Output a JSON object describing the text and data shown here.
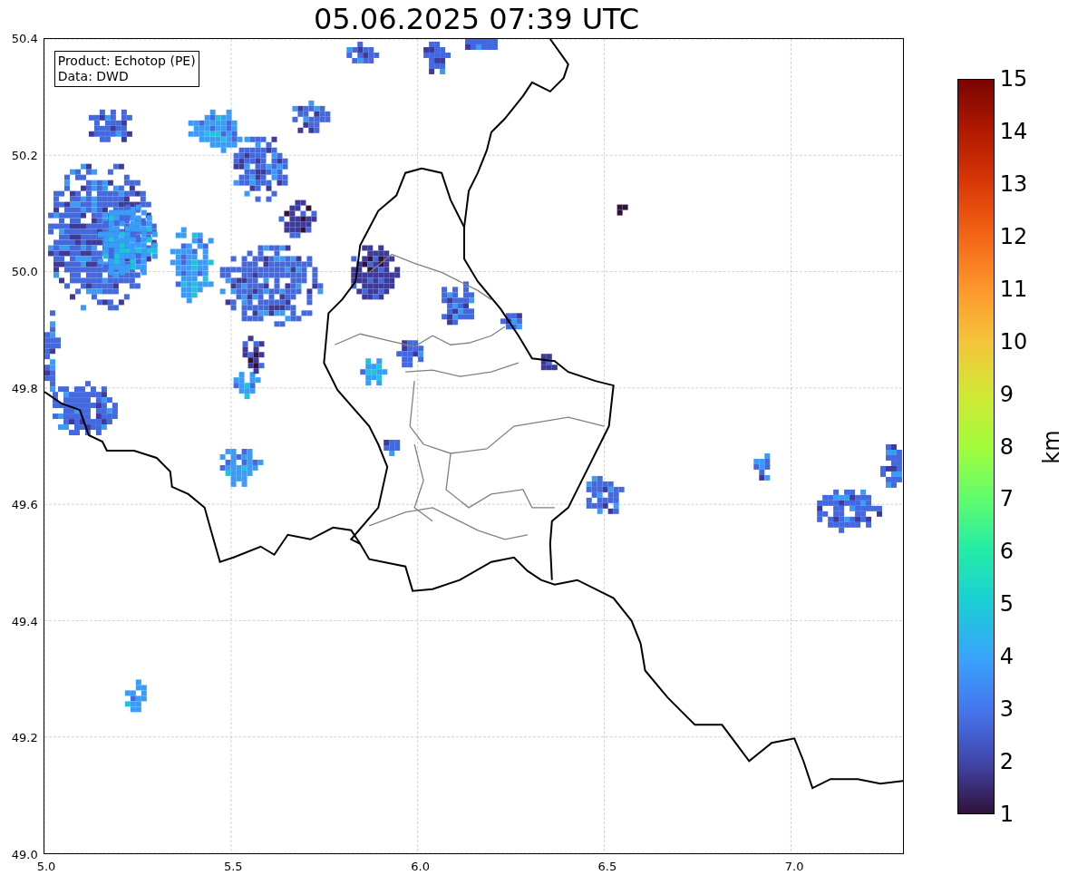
{
  "title": "05.06.2025 07:39 UTC",
  "map": {
    "legend": [
      "Product: Echotop (PE)",
      "Data: DWD"
    ],
    "yticks": [
      "50.4",
      "50.2",
      "50.0",
      "49.8",
      "49.6",
      "49.4",
      "49.2",
      "49.0"
    ],
    "xticks": [
      "5.0",
      "5.5",
      "6.0",
      "6.5",
      "7.0"
    ]
  },
  "colorbar": {
    "label": "km",
    "ticks": [
      "15",
      "14",
      "13",
      "12",
      "11",
      "10",
      "9",
      "8",
      "7",
      "6",
      "5",
      "4",
      "3",
      "2",
      "1"
    ]
  }
}
